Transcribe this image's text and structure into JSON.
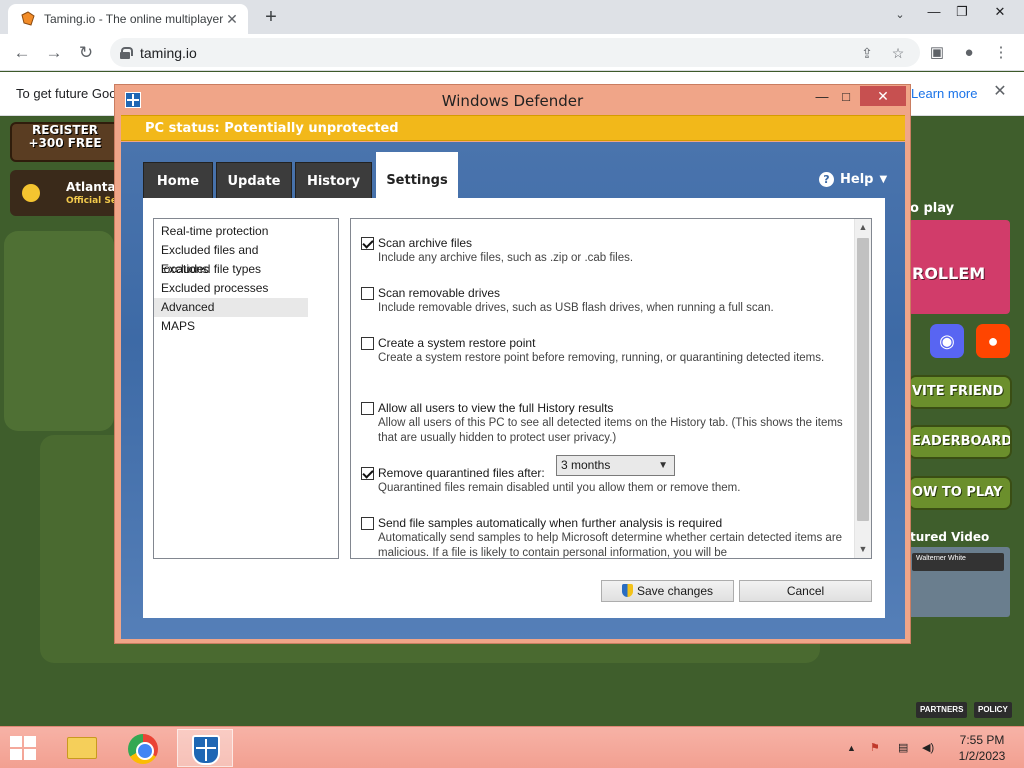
{
  "browser": {
    "tab_title": "Taming.io - The online multiplayer",
    "tab_close": "✕",
    "new_tab": "+",
    "tab_search": "⌄",
    "minimize": "—",
    "restore": "❐",
    "close": "✕",
    "back": "←",
    "forward": "→",
    "reload": "↻",
    "url": "taming.io",
    "share": "⇪",
    "star": "☆",
    "sidepanel": "▣",
    "profile": "●",
    "menu": "⋮",
    "info_text": "To get future Goo",
    "learn_more": "Learn more",
    "info_close": "✕"
  },
  "game": {
    "register_line1": "REGISTER",
    "register_line2": "+300 FREE",
    "server_name": "Atlanta",
    "server_sub": "Official Se",
    "right_title": "o play",
    "thumb_text": "ROLLEM",
    "discord": "◉",
    "reddit": "●",
    "invite": "VITE FRIEND",
    "leaderboard": "EADERBOARD",
    "howto": "OW TO PLAY",
    "video_title": "tured Video",
    "video_label": "Walterner White",
    "partners": "PARTNERS",
    "policy": "POLICY"
  },
  "defender": {
    "title": "Windows Defender",
    "minimize": "—",
    "maximize": "□",
    "close": "✕",
    "status": "PC status: Potentially unprotected",
    "tabs": [
      "Home",
      "Update",
      "History",
      "Settings"
    ],
    "help": "Help",
    "help_icon": "?",
    "help_caret": "▼",
    "nav": [
      "Real-time protection",
      "Excluded files and locations",
      "Excluded file types",
      "Excluded processes",
      "Advanced",
      "MAPS"
    ],
    "options": [
      {
        "label": "Scan archive files",
        "desc": "Include any archive files, such as .zip or .cab files.",
        "checked": true
      },
      {
        "label": "Scan removable drives",
        "desc": "Include removable drives, such as USB flash drives, when running a full scan.",
        "checked": false
      },
      {
        "label": "Create a system restore point",
        "desc": "Create a system restore point before removing, running, or quarantining detected items.",
        "checked": false
      },
      {
        "label": "Allow all users to view the full History results",
        "desc": "Allow all users of this PC to see all detected items on the History tab. (This shows the items that are usually hidden to protect user privacy.)",
        "checked": false
      },
      {
        "label": "Remove quarantined files after:",
        "desc": "Quarantined files remain disabled until you allow them or remove them.",
        "checked": true
      },
      {
        "label": "Send file samples automatically when further analysis is required",
        "desc": "Automatically send samples to help Microsoft determine whether certain detected items are malicious. If a file is likely to contain personal information, you will be",
        "checked": false
      }
    ],
    "quarantine_select": "3 months",
    "scroll_up": "▲",
    "scroll_down": "▼",
    "save": "Save changes",
    "cancel": "Cancel"
  },
  "taskbar": {
    "tray_up": "▲",
    "tray_flag": "⚑",
    "tray_network": "▤",
    "tray_volume": "◀)",
    "time": "7:55 PM",
    "date": "1/2/2023"
  },
  "colors": {
    "status_bar": "#f2b81a",
    "dialog_frame": "#f0a588",
    "dialog_body": "#3d6aa6",
    "taskbar": "#f2a091",
    "page_bg": "#3f5e2c"
  }
}
